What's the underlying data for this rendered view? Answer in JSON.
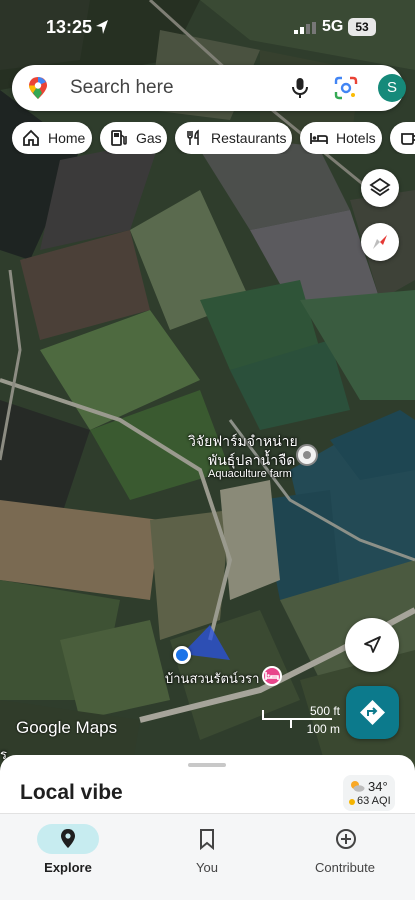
{
  "status_bar": {
    "time": "13:25",
    "network": "5G",
    "battery": "53"
  },
  "search": {
    "placeholder": "Search here",
    "avatar_initial": "S"
  },
  "chips": [
    {
      "label": "Home",
      "icon": "home-icon"
    },
    {
      "label": "Gas",
      "icon": "gas-pump-icon"
    },
    {
      "label": "Restaurants",
      "icon": "fork-knife-icon"
    },
    {
      "label": "Hotels",
      "icon": "bed-icon"
    }
  ],
  "map": {
    "farm_label_line1": "วิจัยฟาร์มจำหน่าย",
    "farm_label_line2": "พันธุ์ปลาน้ำจืด",
    "farm_type": "Aquaculture farm",
    "house_label": "บ้านสวนรัตน์วรา",
    "logo": "Google Maps",
    "scale_ft": "500 ft",
    "scale_m": "100 m",
    "left_edge_fragment": "ร"
  },
  "sheet": {
    "title": "Local vibe"
  },
  "weather": {
    "temp": "34°",
    "aqi": "63 AQI"
  },
  "bottom_nav": [
    {
      "label": "Explore",
      "active": true
    },
    {
      "label": "You",
      "active": false
    },
    {
      "label": "Contribute",
      "active": false
    }
  ],
  "colors": {
    "accent": "#0c7a8c",
    "location_blue": "#1a73e8",
    "hotel_pink": "#e8458b"
  }
}
